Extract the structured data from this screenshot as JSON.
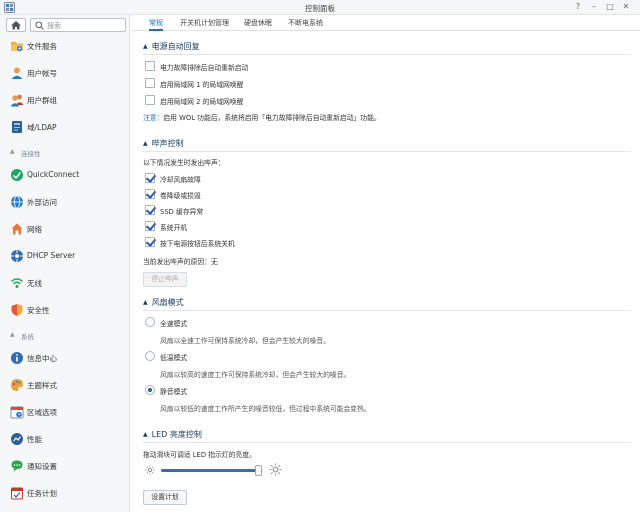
{
  "window": {
    "title": "控制面板"
  },
  "sidebar": {
    "search_placeholder": "搜索",
    "items_top": [
      {
        "label": "文件服务",
        "icon": "folder-share-icon"
      },
      {
        "label": "用户帐号",
        "icon": "user-icon"
      },
      {
        "label": "用户群组",
        "icon": "user-group-icon"
      },
      {
        "label": "域/LDAP",
        "icon": "domain-ldap-icon"
      }
    ],
    "section_connectivity": "连接性",
    "items_connectivity": [
      {
        "label": "QuickConnect",
        "icon": "quickconnect-icon"
      },
      {
        "label": "外部访问",
        "icon": "external-access-icon"
      },
      {
        "label": "网络",
        "icon": "network-icon"
      },
      {
        "label": "DHCP Server",
        "icon": "dhcp-server-icon"
      },
      {
        "label": "无线",
        "icon": "wireless-icon"
      },
      {
        "label": "安全性",
        "icon": "security-shield-icon"
      }
    ],
    "section_system": "系统",
    "items_system": [
      {
        "label": "信息中心",
        "icon": "info-center-icon"
      },
      {
        "label": "主题样式",
        "icon": "theme-palette-icon"
      },
      {
        "label": "区域选项",
        "icon": "regional-options-icon"
      },
      {
        "label": "性能",
        "icon": "performance-icon"
      },
      {
        "label": "通知设置",
        "icon": "notification-icon"
      },
      {
        "label": "任务计划",
        "icon": "task-scheduler-icon"
      }
    ]
  },
  "tabs": [
    {
      "label": "常规",
      "active": true
    },
    {
      "label": "开关机计划管理",
      "active": false
    },
    {
      "label": "硬盘休眠",
      "active": false
    },
    {
      "label": "不断电系统",
      "active": false
    }
  ],
  "power_recovery": {
    "title": "电源自动回复",
    "options": [
      {
        "label": "电力故障排除后自动重新启动",
        "checked": false
      },
      {
        "label": "启用局域网 1 的局域网唤醒",
        "checked": false
      },
      {
        "label": "启用局域网 2 的局域网唤醒",
        "checked": false
      }
    ],
    "note_key": "注意：",
    "note_text": "启用 WOL 功能后，系统将启用「电力故障排除后自动重新启动」功能。"
  },
  "beep_control": {
    "title": "哔声控制",
    "intro": "以下情况发生时发出哔声：",
    "options": [
      {
        "label": "冷却风扇故障",
        "checked": true
      },
      {
        "label": "卷降级或损毁",
        "checked": true
      },
      {
        "label": "SSD 缓存异常",
        "checked": true
      },
      {
        "label": "系统开机",
        "checked": true
      },
      {
        "label": "按下电源按钮后系统关机",
        "checked": true
      }
    ],
    "current_reason_label": "当前发出哔声的原因：",
    "current_reason_value": "无",
    "stop_button": "停止哔声"
  },
  "fan_mode": {
    "title": "风扇模式",
    "options": [
      {
        "label": "全速模式",
        "desc": "风扇以全速工作可保持系统冷却，但会产生较大的噪音。",
        "selected": false
      },
      {
        "label": "低温模式",
        "desc": "风扇以较高的速度工作可保持系统冷却，但会产生较大的噪音。",
        "selected": false
      },
      {
        "label": "静音模式",
        "desc": "风扇以较低的速度工作所产生的噪音较低，但过程中系统可能会变热。",
        "selected": true
      }
    ]
  },
  "led": {
    "title": "LED 亮度控制",
    "desc": "拖动滑块可调适 LED 指示灯的亮度。",
    "brightness_fraction": 0.96,
    "schedule_button": "设置计划"
  },
  "colors": {
    "accent": "#1e6fb8",
    "section_title": "#1a3d66",
    "note": "#1f6bc0"
  }
}
